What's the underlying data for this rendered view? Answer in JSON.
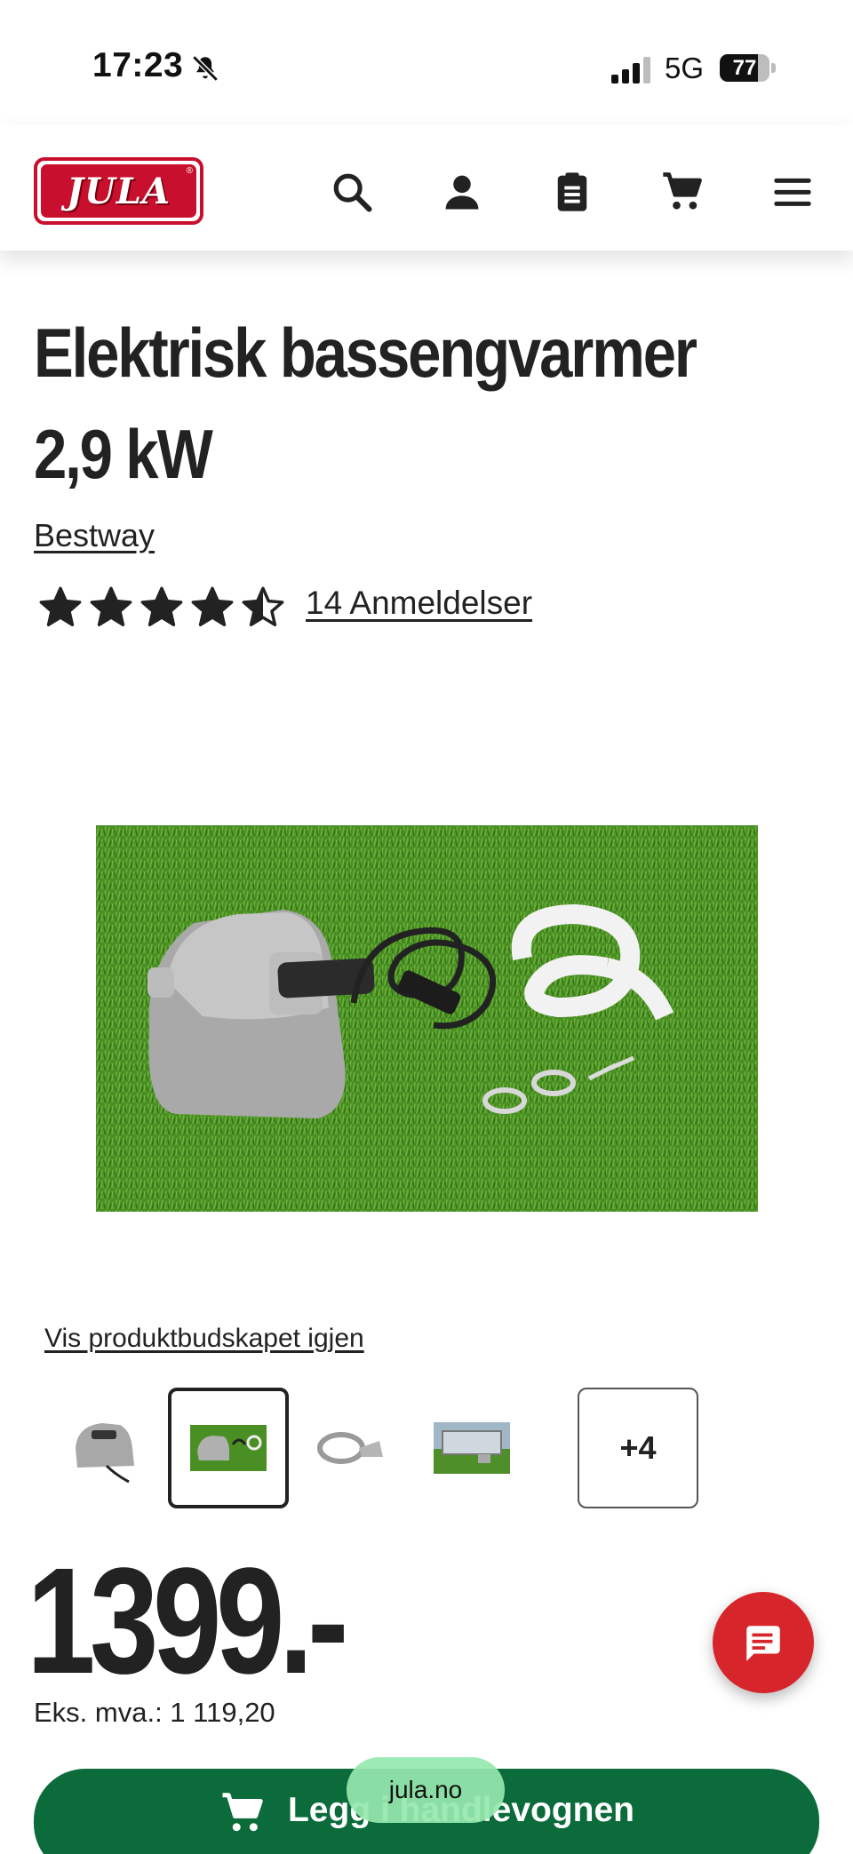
{
  "status_bar": {
    "time": "17:23",
    "network": "5G",
    "battery_level": "77",
    "battery_fraction": 0.77
  },
  "header": {
    "logo_text": "JULA",
    "logo_mark": "®",
    "icons": [
      "search-icon",
      "account-icon",
      "list-icon",
      "cart-icon",
      "menu-icon"
    ]
  },
  "product": {
    "title": "Elektrisk bassengvarmer 2,9 kW",
    "brand": "Bestway",
    "rating": 4.5,
    "rating_max": 5,
    "reviews": "14 Anmeldelser",
    "replay_message": "Vis produktbudskapet igjen",
    "more_images": "+4",
    "price": "1399.-",
    "price_ex_vat": "Eks. mva.: 1 119,20",
    "add_to_cart": "Legg i handlevognen"
  },
  "browser": {
    "url": "jula.no"
  },
  "colors": {
    "brand_red": "#c8102e",
    "cart_green": "#0b6b3a",
    "chat_red": "#d7262b",
    "text": "#222222"
  }
}
